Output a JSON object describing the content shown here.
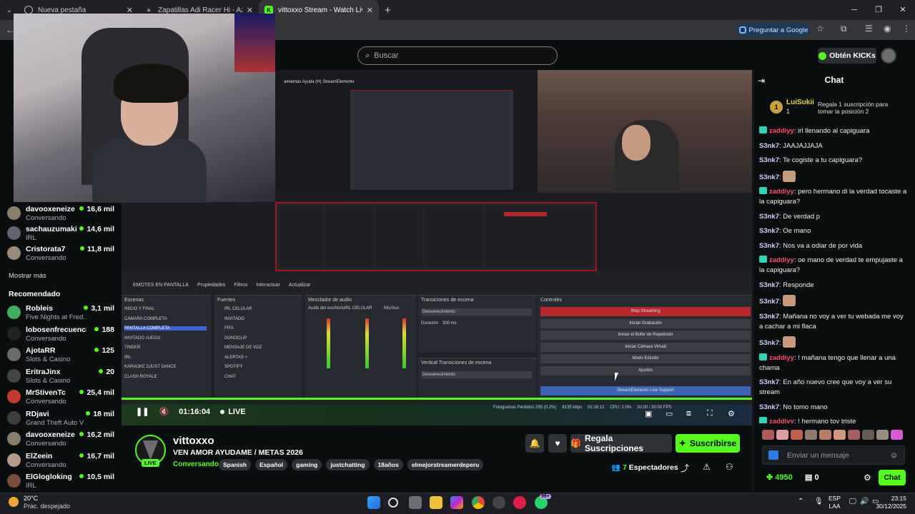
{
  "browser": {
    "tabs": [
      {
        "title": "Nueva pestaña"
      },
      {
        "title": "Zapatillas Adi Racer Hi - Azul adidas"
      },
      {
        "title": "vittoxxo Stream - Watch Live on Kick"
      }
    ],
    "new_tab": "+",
    "ask_google": "Preguntar a Google"
  },
  "site": {
    "search_placeholder": "Buscar",
    "kicks_button": "Obtén KICKs",
    "brand_color": "#53fc18"
  },
  "sidebar": {
    "followed": [
      {
        "name": "davooxeneize",
        "category": "Conversando",
        "viewers": "16,6 mil",
        "color": "#8a7d6a"
      },
      {
        "name": "sachauzumaki",
        "category": "IRL",
        "viewers": "14,6 mil",
        "color": "#5d6470"
      },
      {
        "name": "Cristorata7",
        "category": "Conversando",
        "viewers": "11,8 mil",
        "color": "#9b8a78"
      }
    ],
    "show_more": "Mostrar más",
    "recommended_title": "Recomendado",
    "recommended": [
      {
        "name": "Robleis",
        "category": "Five Nights at Fred...",
        "viewers": "3,1 mil",
        "color": "#3fae5f"
      },
      {
        "name": "lobosenfrecuencia",
        "category": "Conversando",
        "viewers": "188",
        "color": "#222"
      },
      {
        "name": "AjotaRR",
        "category": "Slots & Casino",
        "viewers": "125",
        "color": "#6b6b6b"
      },
      {
        "name": "EritraJinx",
        "category": "Slots & Casino",
        "viewers": "20",
        "color": "#444"
      },
      {
        "name": "MrStivenTc",
        "category": "Conversando",
        "viewers": "25,4 mil",
        "color": "#c43b2e"
      },
      {
        "name": "RDjavi",
        "category": "Grand Theft Auto V ...",
        "viewers": "18 mil",
        "color": "#3d3d3d"
      },
      {
        "name": "davooxeneize",
        "category": "Conversando",
        "viewers": "16,2 mil",
        "color": "#8a7d6a"
      },
      {
        "name": "ElZeein",
        "category": "Conversando",
        "viewers": "16,7 mil",
        "color": "#b09a8a"
      },
      {
        "name": "ElGlogloking",
        "category": "IRL",
        "viewers": "10,5 mil",
        "color": "#7b4b3a"
      }
    ]
  },
  "player": {
    "elapsed": "01:16:04",
    "live_label": "LIVE",
    "obs": {
      "tabs": [
        "EMOTES EN PANTALLA",
        "Propiedades",
        "Filtros",
        "Interactuar",
        "Actualizar"
      ],
      "scenes_title": "Escenas",
      "scenes": [
        "INICIO Y FINAL",
        "CAMARA COMPLETA",
        "PANTALLA COMPLETA",
        "INVITADO JUEGO",
        "TINDER",
        "IRL",
        "KARAOKE DJUST DANCE",
        "CLASH ROYALE"
      ],
      "sources_title": "Fuentes",
      "sources": [
        "IRL CELULAR",
        "INVITADO",
        "FIFA",
        "DONOCLIP",
        "MENSAJE DE VOZ",
        "ALERTAS +",
        "SPOTIFY",
        "CHAT"
      ],
      "mixer_title": "Mezclador de audio",
      "mixer_channels": [
        "Audio del escritorio",
        "IRL CELULAR",
        "Mic/Aux"
      ],
      "transitions_title": "Transiciones de escena",
      "transition_value": "Desvanecimiento",
      "duration_label": "Duración",
      "duration_value": "300 ms",
      "vertical_title": "Vertical Transiciones de escena",
      "vertical_value": "Desvanecimiento",
      "controls_title": "Controles",
      "controls": [
        "Stop Streaming",
        "Iniciar Grabación",
        "Iniciar el Búfer de Repetición",
        "Iniciar Cámara Virtual",
        "Modo Estudio",
        "Ajustes",
        "StreamElements Live Support"
      ],
      "status": [
        "Fotogramas Perdidos 295 (0.2%)",
        "8135 kbps",
        "01:16:12",
        "CPU: 2.0%",
        "30.00 / 30.00 FPS"
      ]
    }
  },
  "streamer": {
    "name": "vittoxxo",
    "title": "VEN AMOR AYUDAME / METAS 2026",
    "category": "Conversando",
    "tags": [
      "Spanish",
      "Español",
      "gaming",
      "justchatting",
      "18años",
      "elmejorstreamerdeperu"
    ],
    "live_badge": "LIVE",
    "gift_button": "Regala Suscripciones",
    "subscribe_button": "Suscribirse",
    "viewers_count": "7",
    "viewers_label": "Espectadores"
  },
  "chat": {
    "title": "Chat",
    "pinned": {
      "rank": "1",
      "user": "LuiSukii",
      "value": "1",
      "text": "Regala 1 suscripción para tomar la posición 2"
    },
    "messages": [
      {
        "user": "zaddiyy",
        "badge": true,
        "text": "irl llenando al capiguara"
      },
      {
        "user": "S3nk7",
        "badge": false,
        "text": "JAAJAJJAJA"
      },
      {
        "user": "S3nk7",
        "badge": false,
        "text": "Te cogiste a tu capiguara?"
      },
      {
        "user": "S3nk7",
        "badge": false,
        "text": "",
        "emote": true
      },
      {
        "user": "zaddiyy",
        "badge": true,
        "text": "pero hermano di la verdad tocaste a la capiguara?"
      },
      {
        "user": "S3nk7",
        "badge": false,
        "text": "De verdad p"
      },
      {
        "user": "S3nk7",
        "badge": false,
        "text": "Oe mano"
      },
      {
        "user": "S3nk7",
        "badge": false,
        "text": "Nos va a odiar de por vida"
      },
      {
        "user": "zaddiyy",
        "badge": true,
        "text": "oe mano de verdad te empujaste a la capiguara?"
      },
      {
        "user": "S3nk7",
        "badge": false,
        "text": "Responde"
      },
      {
        "user": "S3nk7",
        "badge": false,
        "text": "",
        "emote": true
      },
      {
        "user": "S3nk7",
        "badge": false,
        "text": "Mañana no voy a ver tu webada me voy a cachar a mi flaca"
      },
      {
        "user": "S3nk7",
        "badge": false,
        "text": "",
        "emote": true
      },
      {
        "user": "zaddiyy",
        "badge": true,
        "text": "! mañana tengo que llenar a una chama"
      },
      {
        "user": "S3nk7",
        "badge": false,
        "text": "En año nuevo cree que voy a ver su stream"
      },
      {
        "user": "S3nk7",
        "badge": false,
        "text": "No tomo mano"
      },
      {
        "user": "zaddiyy",
        "badge": true,
        "text": "! hermano toy triste"
      }
    ],
    "input_placeholder": "Enviar un mensaje",
    "points": "4950",
    "gifts": "0",
    "send_button": "Chat"
  },
  "taskbar": {
    "temperature": "20°C",
    "weather": "Prac. despejado",
    "lang_line1": "ESP",
    "lang_line2": "LAA",
    "time": "23:15",
    "date": "30/12/2025",
    "notif_badge": "99+"
  }
}
